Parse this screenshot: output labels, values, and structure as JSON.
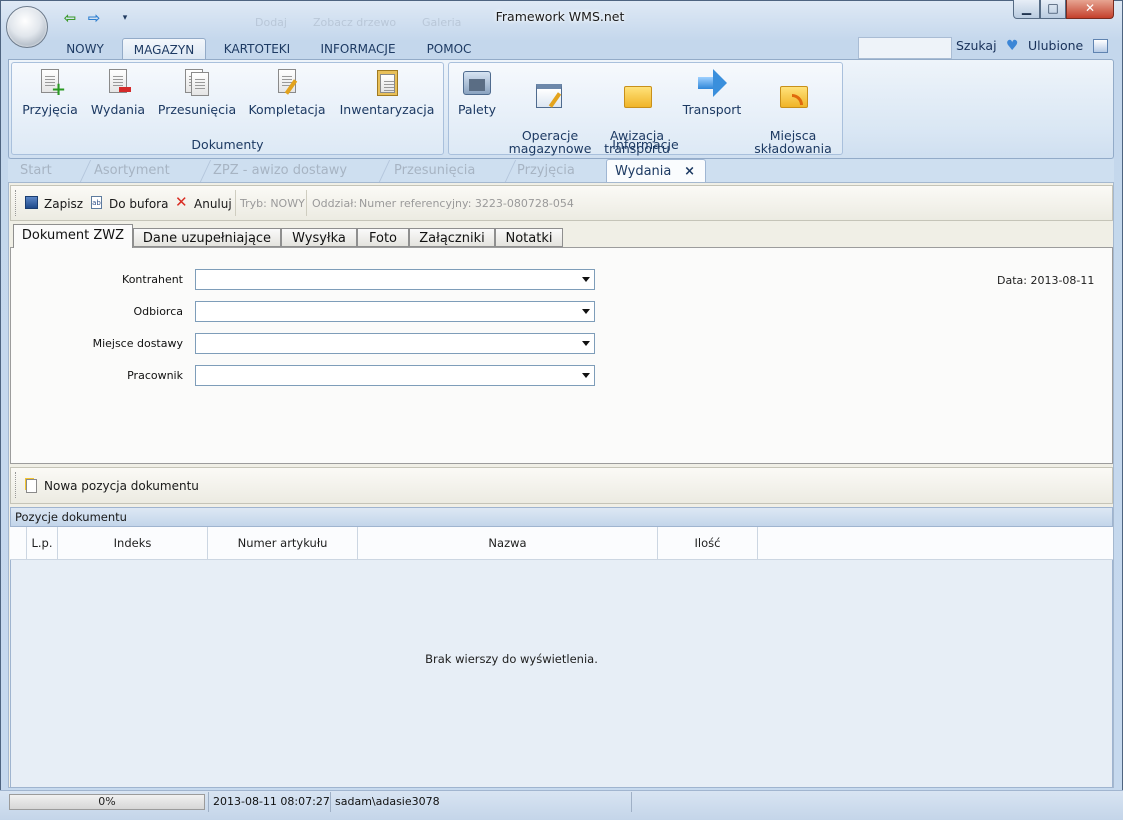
{
  "window": {
    "title": "Framework WMS.net",
    "ghost_items": [
      "Dodaj",
      "Zobacz drzewo",
      "Galeria"
    ],
    "minimize": "▁",
    "maximize": "□",
    "close": "✕"
  },
  "ribbon": {
    "tabs": [
      "NOWY",
      "MAGAZYN",
      "KARTOTEKI",
      "INFORMACJE",
      "POMOC"
    ],
    "active_tab": "MAGAZYN",
    "search_label": "Szukaj",
    "favorites_label": "Ulubione",
    "groups": [
      {
        "label": "Dokumenty",
        "buttons": [
          "Przyjęcia",
          "Wydania",
          "Przesunięcia",
          "Kompletacja",
          "Inwentaryzacja"
        ]
      },
      {
        "label": "Informacje",
        "buttons": [
          "Palety",
          "Operacje\nmagazynowe",
          "Awizacja\ntransportu",
          "Transport",
          "Miejsca\nskładowania"
        ]
      }
    ]
  },
  "doc_tabs": [
    "Start",
    "Asortyment",
    "ZPZ - awizo dostawy",
    "Przesunięcia",
    "Przyjęcia",
    "Wydania"
  ],
  "doc_tabs_close": "×",
  "toolbar": {
    "save": "Zapisz",
    "buffer": "Do bufora",
    "cancel": "Anuluj",
    "mode": "Tryb: NOWY",
    "branch": "Oddział:",
    "reference": "Numer referencyjny: 3223-080728-054"
  },
  "sub_tabs": [
    "Dokument ZWZ",
    "Dane uzupełniające",
    "Wysyłka",
    "Foto",
    "Załączniki",
    "Notatki"
  ],
  "form": {
    "fields": [
      {
        "label": "Kontrahent",
        "value": ""
      },
      {
        "label": "Odbiorca",
        "value": ""
      },
      {
        "label": "Miejsce dostawy",
        "value": ""
      },
      {
        "label": "Pracownik",
        "value": ""
      }
    ],
    "date": "Data: 2013-08-11"
  },
  "positions": {
    "new_item": "Nowa pozycja dokumentu",
    "header": "Pozycje dokumentu",
    "columns": [
      "L.p.",
      "Indeks",
      "Numer artykułu",
      "Nazwa",
      "Ilość"
    ],
    "empty_text": "Brak wierszy do wyświetlenia."
  },
  "status": {
    "progress": "0%",
    "progress_value": 0,
    "datetime": "2013-08-11 08:07:27",
    "user": "sadam\\adasie3078"
  },
  "colors": {
    "accent": "#1d3a63",
    "ribbon": "#dae7f4",
    "panel": "#f0efe6"
  }
}
